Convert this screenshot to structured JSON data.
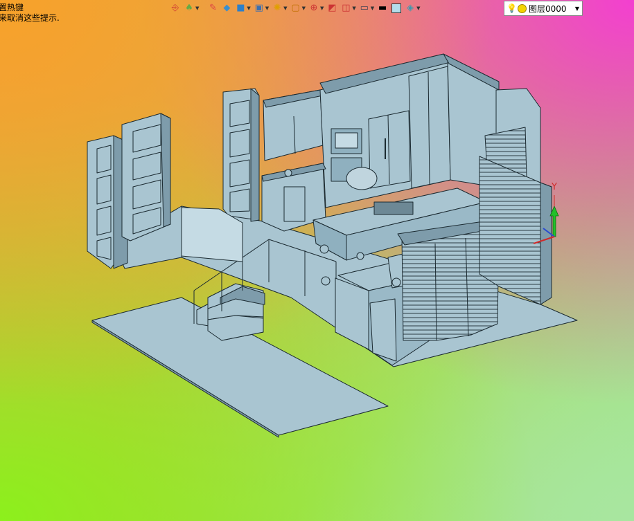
{
  "hints": {
    "line1": "置热键",
    "line2": "来取消这些提示."
  },
  "toolbar": {
    "icons": [
      "exit-sketch-icon",
      "paint-bucket-icon",
      "pen-icon",
      "box-solid-icon",
      "cube-view-icon",
      "shaded-view-icon",
      "color-wheel-icon",
      "zoom-window-icon",
      "origin-icon",
      "section-icon",
      "split-view-icon",
      "display-icon",
      "line-weight-icon",
      "fill-color-icon",
      "layer-manager-icon"
    ]
  },
  "layer": {
    "current": "图层0000"
  },
  "triad": {
    "y_label": "Y"
  },
  "colors": {
    "model_fill": "#a9c5d1",
    "model_dark": "#7e9cab",
    "model_edge": "#1b2a31"
  }
}
